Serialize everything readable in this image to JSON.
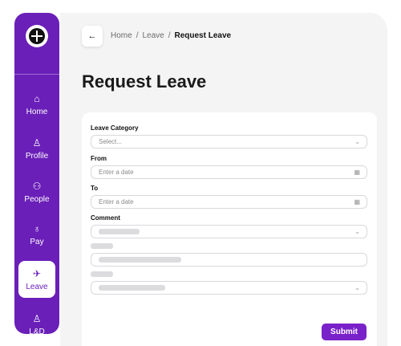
{
  "sidebar": {
    "items": [
      {
        "label": "Home",
        "icon": "⌂"
      },
      {
        "label": "Profile",
        "icon": "♙"
      },
      {
        "label": "People",
        "icon": "⚇"
      },
      {
        "label": "Pay",
        "icon": "♁"
      },
      {
        "label": "Leave",
        "icon": "✈"
      },
      {
        "label": "L&D",
        "icon": "♙"
      }
    ],
    "active": "Leave"
  },
  "header": {
    "back_icon": "←",
    "breadcrumb": [
      "Home",
      "Leave",
      "Request Leave"
    ],
    "separator": "/"
  },
  "page": {
    "title": "Request Leave"
  },
  "form": {
    "category_label": "Leave Category",
    "category_placeholder": "Select...",
    "from_label": "From",
    "from_placeholder": "Enter a date",
    "to_label": "To",
    "to_placeholder": "Enter a date",
    "comment_label": "Comment",
    "chevron": "⌄",
    "calendar_icon": "▦",
    "submit_label": "Submit"
  },
  "colors": {
    "accent": "#6a1fb8",
    "button": "#7a22c9",
    "background": "#f4f4f5"
  }
}
